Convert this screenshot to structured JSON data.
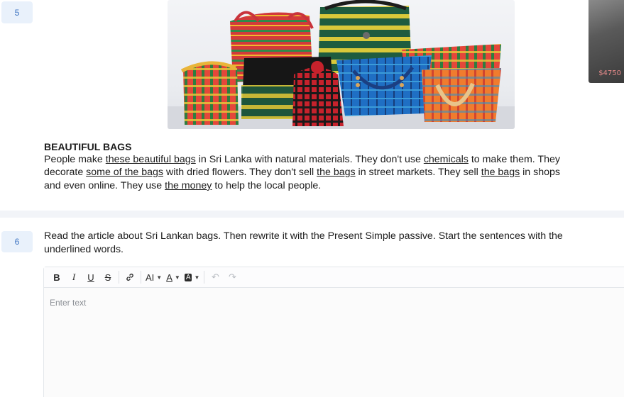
{
  "questions": [
    {
      "number": "5"
    },
    {
      "number": "6"
    }
  ],
  "article": {
    "title": "BEAUTIFUL BAGS",
    "line1": [
      {
        "t": "People make ",
        "u": false
      },
      {
        "t": "these beautiful bags",
        "u": true
      },
      {
        "t": " in Sri Lanka with natural materials. They don't use ",
        "u": false
      },
      {
        "t": "chemicals",
        "u": true
      },
      {
        "t": " to make them. They",
        "u": false
      }
    ],
    "line2": [
      {
        "t": "decorate ",
        "u": false
      },
      {
        "t": "some of the bags",
        "u": true
      },
      {
        "t": " with dried flowers. They don't sell ",
        "u": false
      },
      {
        "t": "the bags",
        "u": true
      },
      {
        "t": " in street markets. They sell ",
        "u": false
      },
      {
        "t": "the bags",
        "u": true
      },
      {
        "t": " in shops",
        "u": false
      }
    ],
    "line3": [
      {
        "t": "and even online. They use ",
        "u": false
      },
      {
        "t": "the money",
        "u": true
      },
      {
        "t": " to help the local people.",
        "u": false
      }
    ]
  },
  "thumbnail": {
    "price": "$4750"
  },
  "instruction": {
    "line1": "Read the article about Sri Lankan bags. Then rewrite it with the Present Simple passive. Start the sentences with the",
    "line2": "underlined words."
  },
  "editor": {
    "placeholder": "Enter text",
    "toolbar": {
      "bold": "B",
      "italic": "I",
      "underline": "U",
      "strike": "S",
      "text_size": "AI",
      "text_color": "A",
      "highlight": "A",
      "undo": "↶",
      "redo": "↷"
    }
  },
  "colors": {
    "question_badge_bg": "#e9f1fb",
    "question_badge_text": "#3d74c2",
    "divider": "#f2f4f8"
  }
}
